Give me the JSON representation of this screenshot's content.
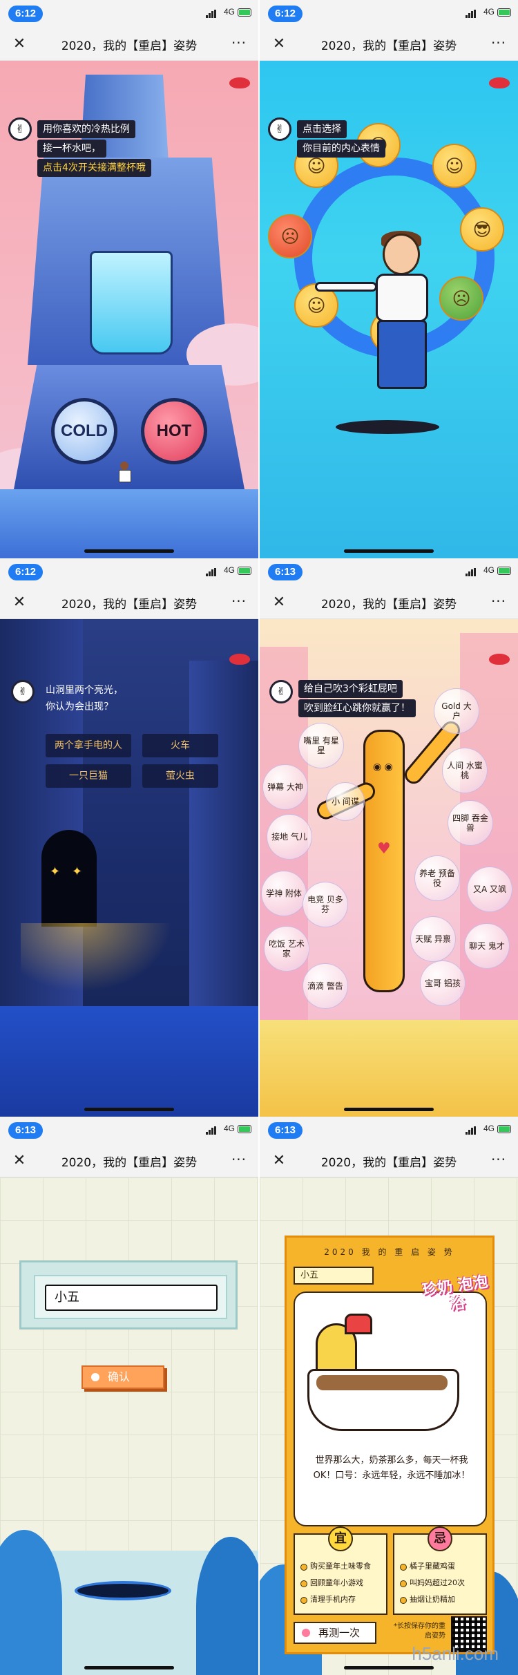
{
  "common": {
    "title": "2020，我的【重启】姿势",
    "network": "4G",
    "close_glyph": "✕",
    "more_glyph": "···"
  },
  "screens": [
    {
      "time": "6:12",
      "prompt": [
        "用你喜欢的冷热比例",
        "接一杯水吧，",
        "点击4次开关接满整杯哦"
      ],
      "cold_label": "COLD",
      "hot_label": "HOT"
    },
    {
      "time": "6:12",
      "prompt": [
        "点击选择",
        "你目前的内心表情"
      ]
    },
    {
      "time": "6:12",
      "prompt": [
        "山洞里两个亮光，",
        "你认为会出现？"
      ],
      "options": [
        "两个拿手电的人",
        "火车",
        "一只巨猫",
        "萤火虫"
      ]
    },
    {
      "time": "6:13",
      "prompt": [
        "给自己吹3个彩虹屁吧",
        "吹到脸红心跳你就赢了！"
      ],
      "bubbles": [
        "Gold 大户",
        "嘴里 有星星",
        "人间 水蜜桃",
        "弹幕 大神",
        "小 间谍",
        "四脚 吞金兽",
        "接地 气儿",
        "养老 预备役",
        "又A 又飒",
        "学神 附体",
        "电竞 贝多芬",
        "吃饭 艺术家",
        "天赋 异禀",
        "聊天 鬼才",
        "滴滴 警告",
        "宝哥 铝孩"
      ]
    },
    {
      "time": "6:13",
      "name_value": "小五",
      "confirm_label": "确认"
    },
    {
      "time": "6:13",
      "card_title": "2020 我 的 重 启 姿 势",
      "name_value": "小五",
      "badge": "珍奶 泡泡浴",
      "description": "世界那么大，奶茶那么多，每天一杯我OK！口号：永远年轻，永远不睡加冰！",
      "yi_label": "宜",
      "yi_items": [
        "购买童年土味零食",
        "回顾童年小游戏",
        "清理手机内存"
      ],
      "ji_label": "忌",
      "ji_items": [
        "橘子里藏鸡蛋",
        "叫妈妈超过20次",
        "抽烟让奶精加"
      ],
      "retry_label": "再测一次",
      "qr_text": "*长按保存你的重启姿势"
    }
  ],
  "watermark": "h5anli.com"
}
